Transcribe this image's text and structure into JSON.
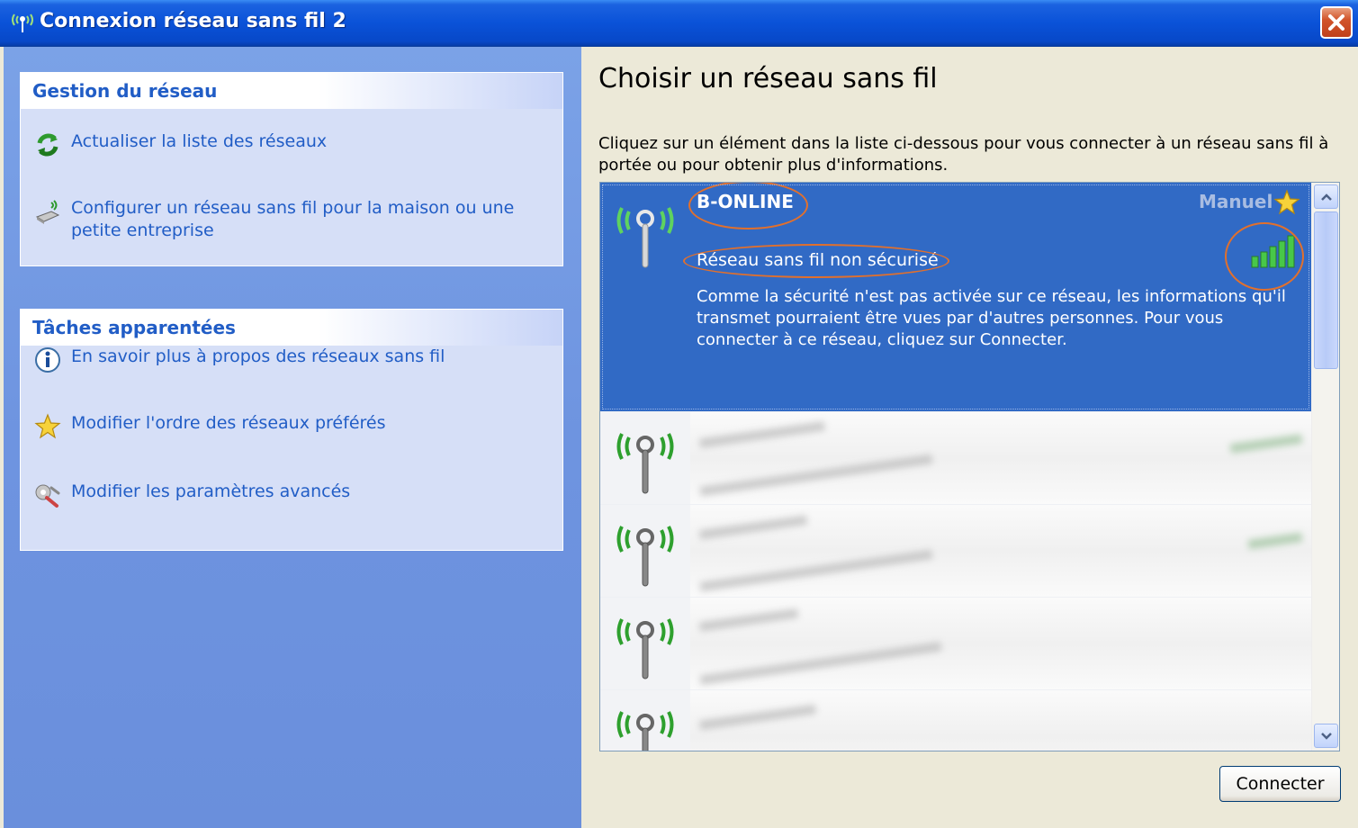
{
  "window": {
    "title": "Connexion réseau sans fil 2",
    "close_icon": "close-icon"
  },
  "left": {
    "network_panel": {
      "title": "Gestion du réseau",
      "items": [
        {
          "label": "Actualiser la liste des réseaux",
          "icon": "refresh-icon"
        },
        {
          "label": "Configurer un réseau sans fil pour la maison ou une petite entreprise",
          "icon": "wireless-setup-icon"
        }
      ]
    },
    "tasks_panel": {
      "title": "Tâches apparentées",
      "items": [
        {
          "label": "En savoir plus à propos des réseaux sans fil",
          "icon": "info-icon"
        },
        {
          "label": "Modifier l'ordre des réseaux préférés",
          "icon": "star-icon"
        },
        {
          "label": "Modifier les paramètres avancés",
          "icon": "settings-icon"
        }
      ]
    }
  },
  "main": {
    "heading": "Choisir un réseau sans fil",
    "instructions": "Cliquez sur un élément dans la liste ci-dessous pour vous connecter à un réseau sans fil à portée ou pour obtenir plus d'informations.",
    "selected_network": {
      "ssid": "B-ONLINE",
      "mode": "Manuel",
      "security": "Réseau sans fil non sécurisé",
      "description": "Comme la sécurité n'est pas activée sur ce réseau, les informations qu'il transmet pourraient être vues par d'autres personnes. Pour vous connecter à ce réseau, cliquez sur Connecter.",
      "signal_bars": 5,
      "signal_max": 5
    },
    "connect_label": "Connecter"
  },
  "colors": {
    "titlebar": "#0a52d8",
    "selection": "#316ac5",
    "link": "#215dc6",
    "annotation": "#e2702c",
    "signal": "#48c848"
  }
}
